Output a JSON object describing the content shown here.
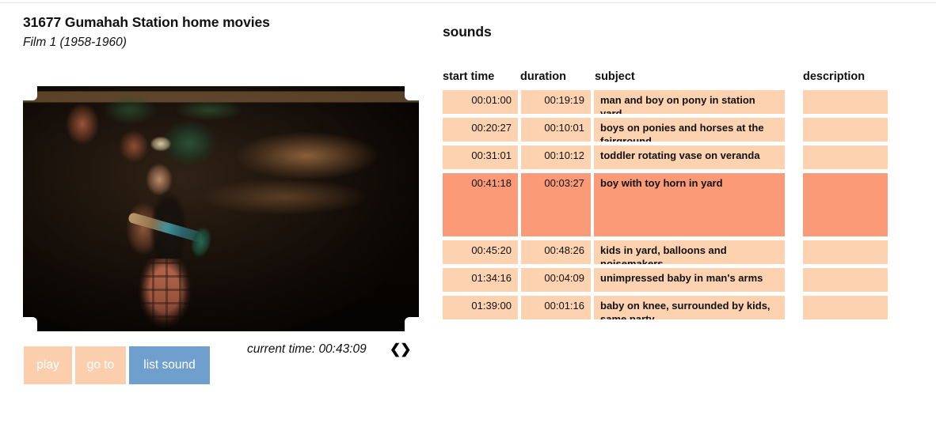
{
  "film": {
    "title": "31677 Gumahah Station home movies",
    "subtitle": "Film 1 (1958-1960)",
    "frame_alt": "colour film frame of a small boy in plaid trousers and paper hat holding a toy horn in a station yard"
  },
  "controls": {
    "play_label": "play",
    "goto_label": "go to",
    "list_sound_label": "list sound",
    "current_time_label": "current time: 00:43:09",
    "prev_arrow": "❮",
    "next_arrow": "❯"
  },
  "sounds_panel": {
    "heading": "sounds",
    "columns": {
      "start_time": "start time",
      "duration": "duration",
      "subject": "subject",
      "description": "description"
    },
    "rows": [
      {
        "start_time": "00:01:00",
        "duration": "00:19:19",
        "subject": "man and boy on pony in station yard",
        "description": "",
        "selected": false
      },
      {
        "start_time": "00:20:27",
        "duration": "00:10:01",
        "subject": "boys on ponies and horses at the fairground",
        "description": "",
        "selected": false
      },
      {
        "start_time": "00:31:01",
        "duration": "00:10:12",
        "subject": "toddler rotating vase on veranda",
        "description": "",
        "selected": false
      },
      {
        "start_time": "00:41:18",
        "duration": "00:03:27",
        "subject": "boy with toy horn in yard",
        "description": "",
        "selected": true
      },
      {
        "start_time": "00:45:20",
        "duration": "00:48:26",
        "subject": "kids in yard, balloons and noisemakers",
        "description": "",
        "selected": false
      },
      {
        "start_time": "01:34:16",
        "duration": "00:04:09",
        "subject": "unimpressed baby in man's arms",
        "description": "",
        "selected": false
      },
      {
        "start_time": "01:39:00",
        "duration": "00:01:16",
        "subject": "baby on knee, surrounded by kids, same party",
        "description": "",
        "selected": false
      }
    ]
  },
  "colors": {
    "row_default": "#fcd2b0",
    "row_selected": "#fa9a77",
    "button_peach": "#fbcfae",
    "button_blue": "#6fa0cd",
    "page_background": "#ffffff",
    "text": "#111111"
  }
}
